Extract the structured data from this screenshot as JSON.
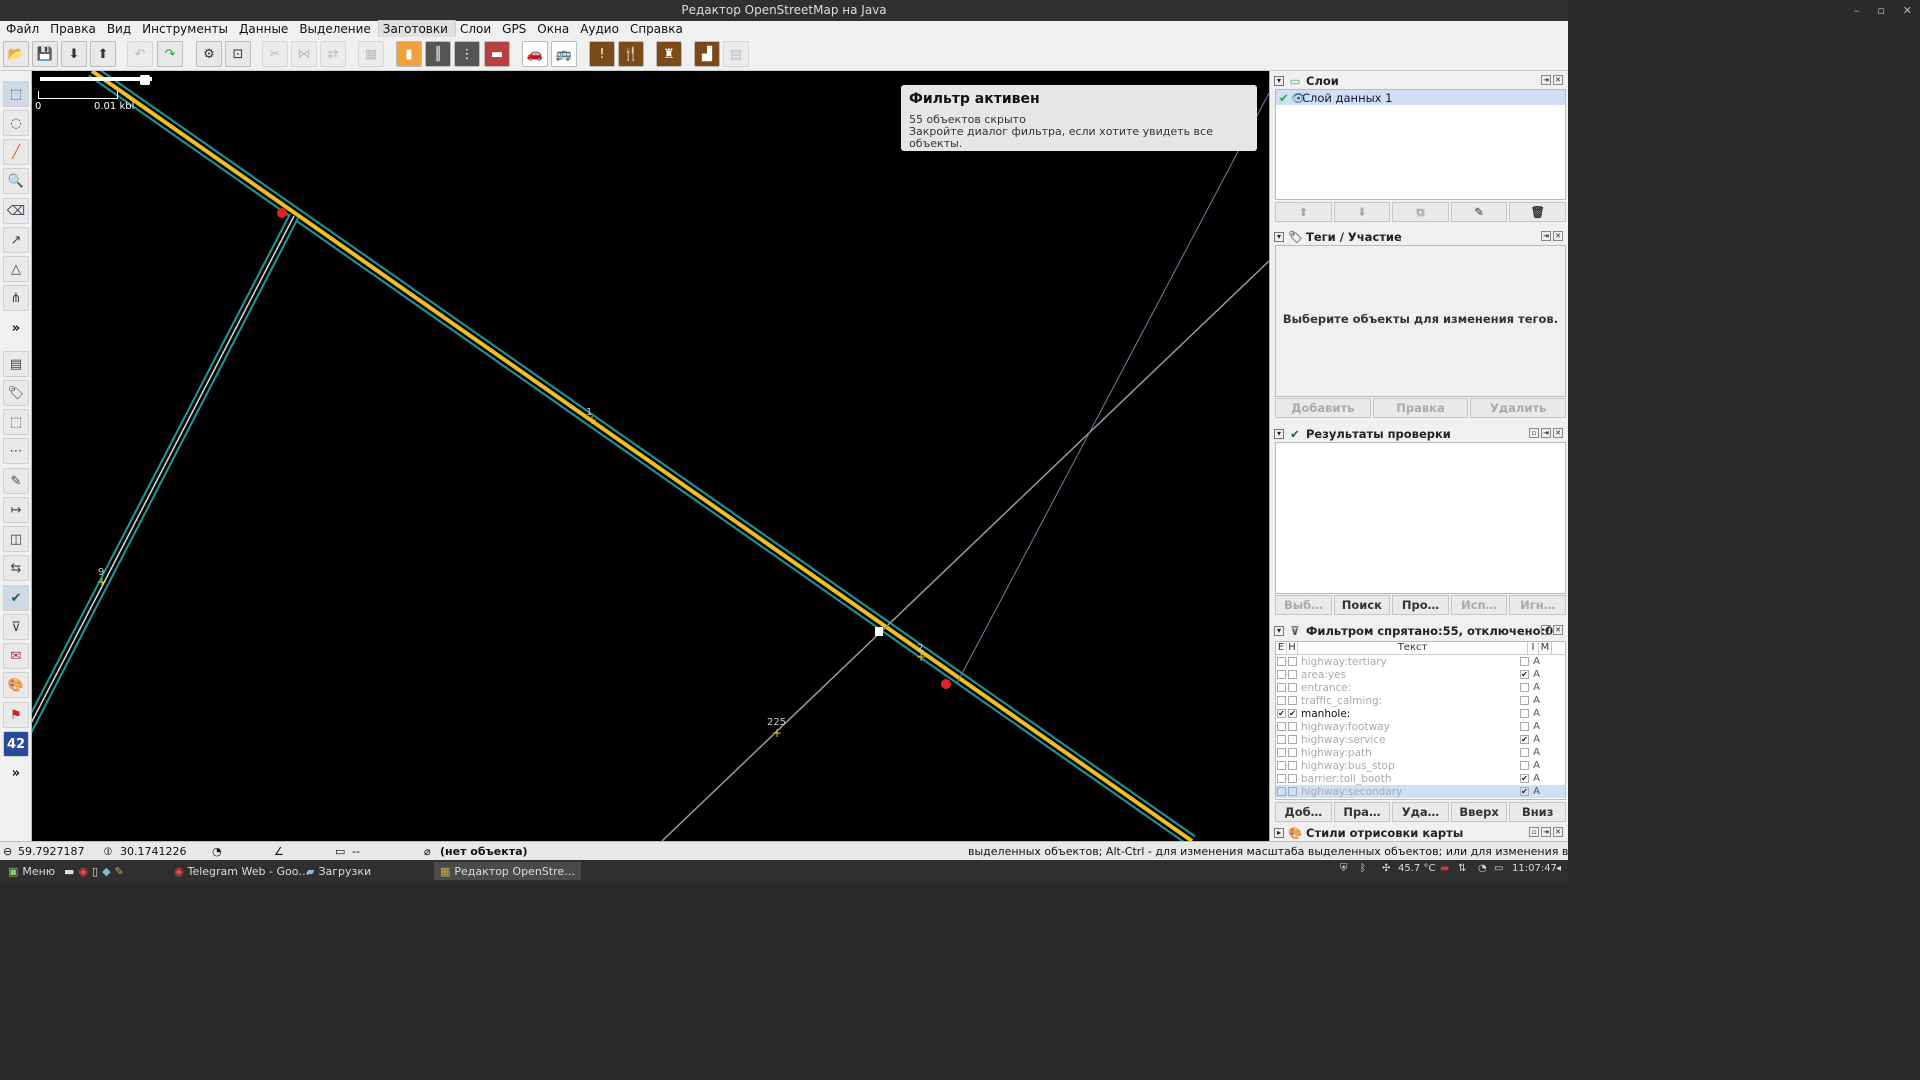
{
  "window": {
    "title": "Редактор OpenStreetMap на Java"
  },
  "menu": [
    "Файл",
    "Правка",
    "Вид",
    "Инструменты",
    "Данные",
    "Выделение",
    "Заготовки",
    "Слои",
    "GPS",
    "Окна",
    "Аудио",
    "Справка"
  ],
  "map": {
    "scale": {
      "zero": "0",
      "unit": "0.01 kbl"
    },
    "filter_notice": {
      "title": "Фильтр активен",
      "count": "55",
      "hidden_text": "объектов скрыто",
      "hint": "Закройте диалог фильтра, если хотите увидеть все объекты."
    },
    "labels": {
      "node_1": "1",
      "node_2": "2",
      "node_9": "9",
      "node_225": "225"
    }
  },
  "panels": {
    "layers": {
      "title": "Слои",
      "items": [
        "Слой данных 1"
      ]
    },
    "tags": {
      "title": "Теги / Участие",
      "empty_msg": "Выберите объекты для изменения тегов.",
      "buttons": [
        "Добавить",
        "Правка",
        "Удалить"
      ]
    },
    "validation": {
      "title": "Результаты проверки",
      "buttons": [
        "Выб…",
        "Поиск",
        "Про…",
        "Исп…",
        "Игн…"
      ]
    },
    "filter": {
      "title": "Фильтром спрятано:55, отключено:0",
      "columns": {
        "e": "E",
        "h": "H",
        "text": "Текст",
        "i": "I",
        "m": "M"
      },
      "rows": [
        {
          "text": "highway:tertiary",
          "on": false,
          "i": false,
          "m": "A"
        },
        {
          "text": "area:yes",
          "on": false,
          "i": true,
          "m": "A"
        },
        {
          "text": "entrance:",
          "on": false,
          "i": false,
          "m": "A"
        },
        {
          "text": "traffic_calming:",
          "on": false,
          "i": false,
          "m": "A"
        },
        {
          "text": "manhole:",
          "on": true,
          "i": false,
          "m": "A"
        },
        {
          "text": "highway:footway",
          "on": false,
          "i": false,
          "m": "A"
        },
        {
          "text": "highway:service",
          "on": false,
          "i": true,
          "m": "A"
        },
        {
          "text": "highway:path",
          "on": false,
          "i": false,
          "m": "A"
        },
        {
          "text": "highway:bus_stop",
          "on": false,
          "i": false,
          "m": "A"
        },
        {
          "text": "barrier:toll_booth",
          "on": false,
          "i": true,
          "m": "A"
        },
        {
          "text": "highway:secondary",
          "on": false,
          "i": true,
          "m": "A"
        }
      ],
      "buttons": [
        "Доб…",
        "Пра…",
        "Уда…",
        "Вверх",
        "Вниз"
      ]
    },
    "styles": {
      "title": "Стили отрисовки карты"
    }
  },
  "status": {
    "lat": "59.7927187",
    "lon": "30.1741226",
    "angle": "--",
    "object": "(нет объекта)",
    "help": "выделенных объектов; Alt-Ctrl - для изменения масштаба выделенных объектов; или для изменения выделения"
  },
  "taskbar": {
    "menu": "Меню",
    "tasks": [
      "Telegram Web - Goo…",
      "Загрузки",
      "Редактор OpenStre…"
    ],
    "temp": "45.7 °C",
    "time": "11:07:47"
  },
  "colors": {
    "road": "#f0c020",
    "casing": "#1a9a9a",
    "line": "#b0b0b0"
  }
}
